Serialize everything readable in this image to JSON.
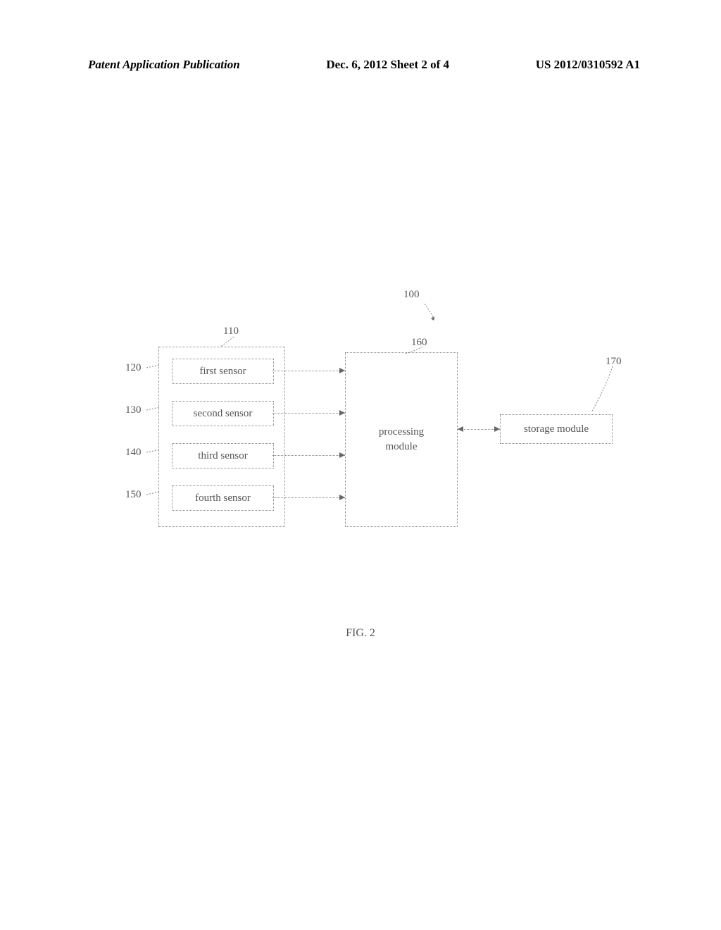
{
  "header": {
    "left": "Patent Application Publication",
    "center": "Dec. 6, 2012  Sheet 2 of 4",
    "right": "US 2012/0310592 A1"
  },
  "diagram": {
    "refs": {
      "system": "100",
      "sensor_group": "110",
      "sensor1": "120",
      "sensor2": "130",
      "sensor3": "140",
      "sensor4": "150",
      "processing": "160",
      "storage": "170"
    },
    "labels": {
      "sensor1": "first sensor",
      "sensor2": "second sensor",
      "sensor3": "third sensor",
      "sensor4": "fourth sensor",
      "processing": "processing\nmodule",
      "storage": "storage module"
    }
  },
  "caption": "FIG. 2"
}
